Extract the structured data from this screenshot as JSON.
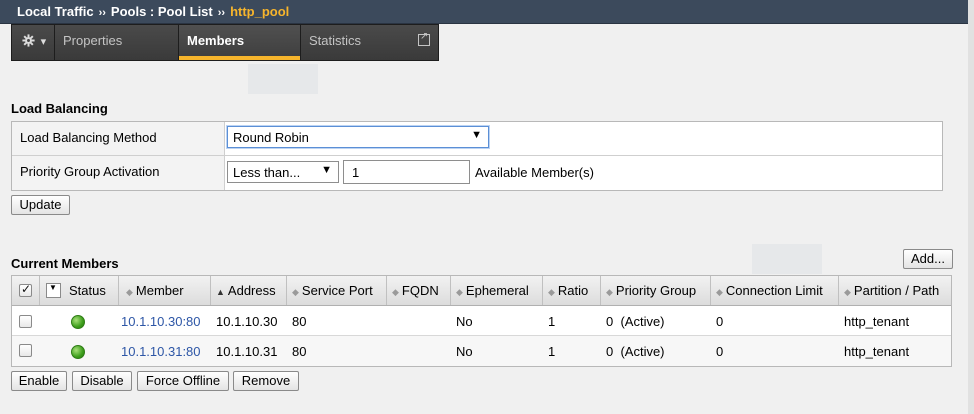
{
  "breadcrumb": {
    "part1": "Local Traffic",
    "sep": "››",
    "part2": "Pools : Pool List",
    "current": "http_pool"
  },
  "tabs": {
    "gear_icon": "gear-icon",
    "gear_caret": "▾",
    "properties": "Properties",
    "members": "Members",
    "statistics": "Statistics"
  },
  "load_balancing": {
    "title": "Load Balancing",
    "method_label": "Load Balancing Method",
    "method_value": "Round Robin",
    "pga_label": "Priority Group Activation",
    "pga_value": "Less than...",
    "pga_number": "1",
    "pga_suffix": "Available Member(s)",
    "update_button": "Update"
  },
  "current_members": {
    "title": "Current Members",
    "add_button": "Add...",
    "columns": {
      "status": "Status",
      "member": "Member",
      "address": "Address",
      "service_port": "Service Port",
      "fqdn": "FQDN",
      "ephemeral": "Ephemeral",
      "ratio": "Ratio",
      "priority_group": "Priority Group",
      "connection_limit": "Connection Limit",
      "partition_path": "Partition / Path"
    },
    "rows": [
      {
        "status_color": "#3d9e1c",
        "member": "10.1.10.30:80",
        "address": "10.1.10.30",
        "service_port": "80",
        "fqdn": "",
        "ephemeral": "No",
        "ratio": "1",
        "priority_group": "0  (Active)",
        "connection_limit": "0",
        "partition_path": "http_tenant"
      },
      {
        "status_color": "#3d9e1c",
        "member": "10.1.10.31:80",
        "address": "10.1.10.31",
        "service_port": "80",
        "fqdn": "",
        "ephemeral": "No",
        "ratio": "1",
        "priority_group": "0  (Active)",
        "connection_limit": "0",
        "partition_path": "http_tenant"
      }
    ],
    "buttons": {
      "enable": "Enable",
      "disable": "Disable",
      "force_offline": "Force Offline",
      "remove": "Remove"
    }
  },
  "colors": {
    "titlebar": "#3c4a5c",
    "active_tab_accent": "#f7b52c",
    "link": "#2d56a6",
    "status_available": "#3d9e1c"
  }
}
